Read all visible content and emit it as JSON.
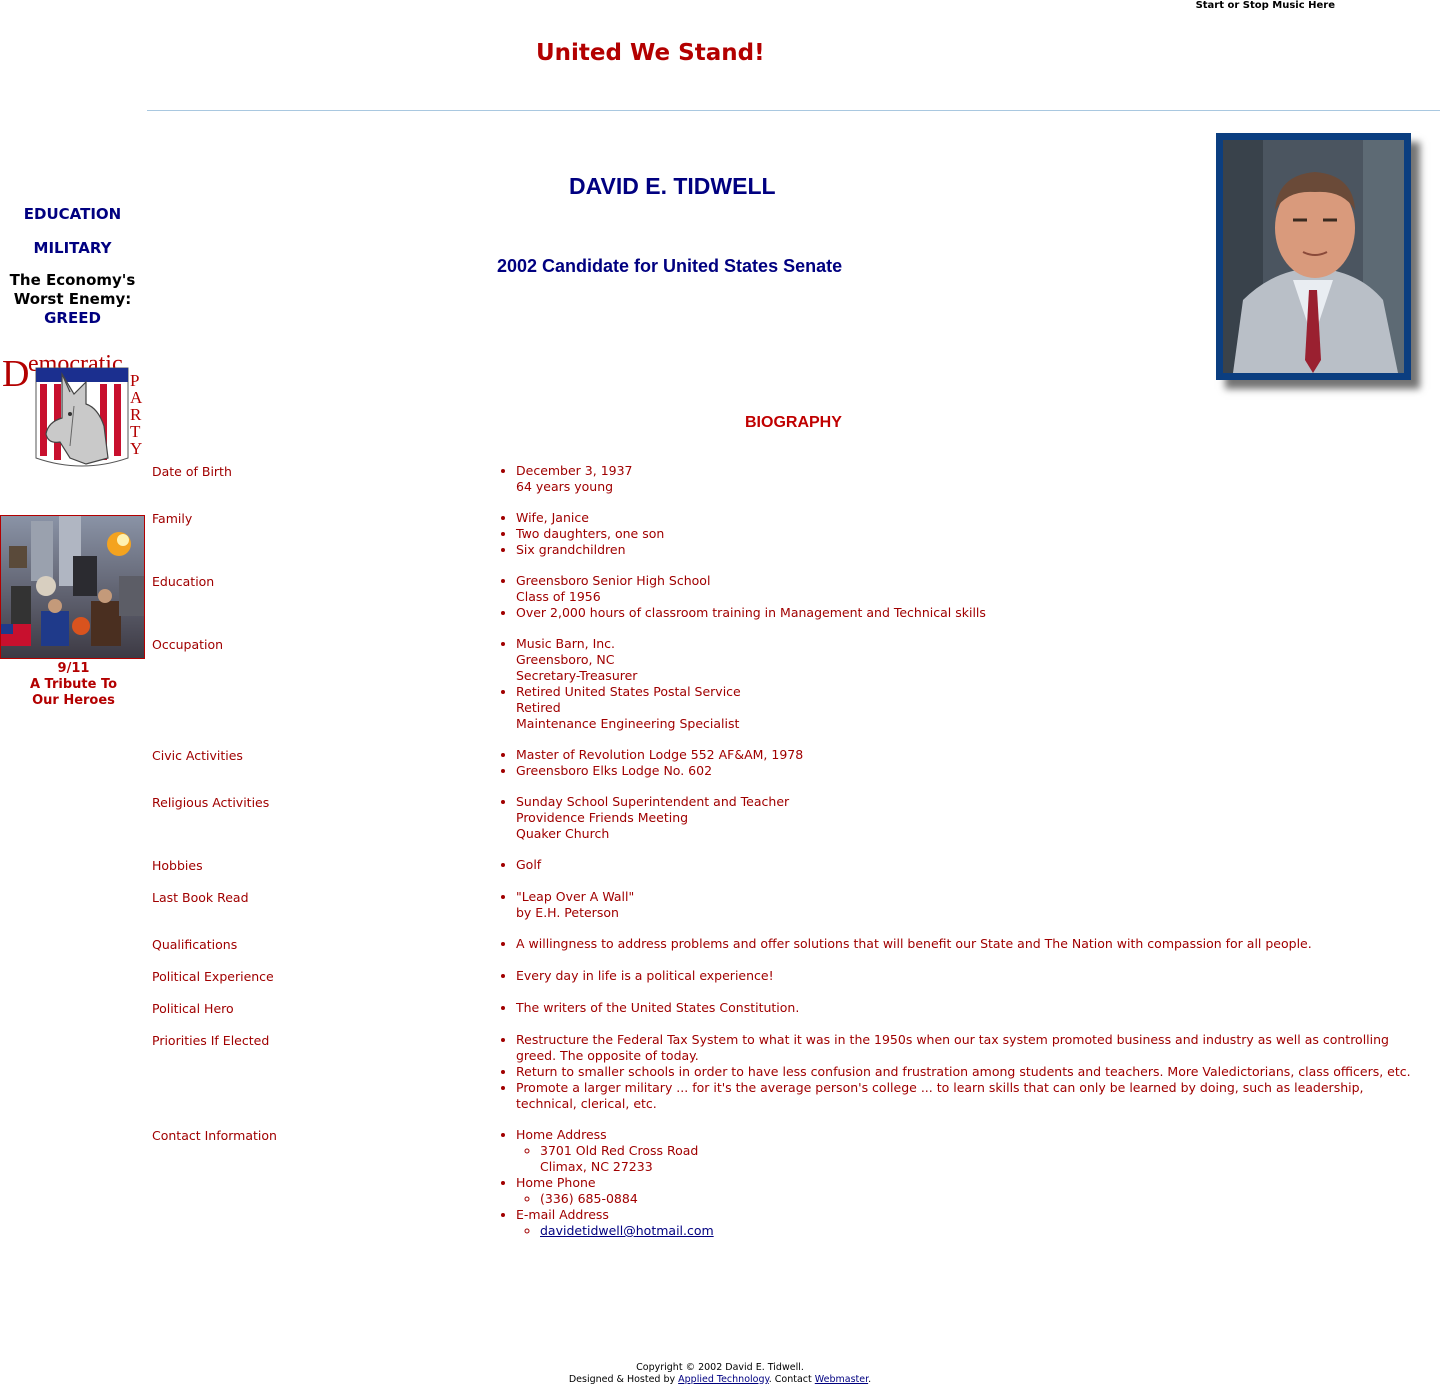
{
  "header": {
    "music_link": "Start or Stop Music Here",
    "tagline": "United We Stand!"
  },
  "sidebar": {
    "nav": [
      {
        "label": "EDUCATION"
      },
      {
        "label": "MILITARY"
      }
    ],
    "economy_line1": "The Economy's",
    "economy_line2": "Worst Enemy:",
    "economy_link": "GREED",
    "logo_word_democratic": "Democratic",
    "logo_word_party": "PARTY",
    "tribute_line1": "9/11",
    "tribute_line2": "A Tribute To",
    "tribute_line3": "Our Heroes"
  },
  "main": {
    "name": "DAVID E. TIDWELL",
    "subtitle": "2002 Candidate for United States Senate",
    "bio_title": "BIOGRAPHY",
    "bio": [
      {
        "label": "Date of Birth",
        "items": [
          [
            "December 3, 1937",
            "64 years young"
          ]
        ]
      },
      {
        "label": "Family",
        "items": [
          [
            "Wife, Janice"
          ],
          [
            "Two daughters, one son"
          ],
          [
            "Six grandchildren"
          ]
        ]
      },
      {
        "label": "Education",
        "items": [
          [
            "Greensboro Senior High School",
            "Class of 1956"
          ],
          [
            "Over 2,000 hours of classroom training in Management and Technical skills"
          ]
        ]
      },
      {
        "label": "Occupation",
        "items": [
          [
            "Music Barn, Inc.",
            "Greensboro, NC",
            "Secretary-Treasurer"
          ],
          [
            "Retired United States Postal Service",
            "Retired",
            "Maintenance Engineering Specialist"
          ]
        ]
      },
      {
        "label": "Civic Activities",
        "items": [
          [
            "Master of Revolution Lodge 552 AF&AM, 1978"
          ],
          [
            "Greensboro Elks Lodge No. 602"
          ]
        ]
      },
      {
        "label": "Religious Activities",
        "items": [
          [
            "Sunday School Superintendent and Teacher",
            "Providence Friends Meeting",
            "Quaker Church"
          ]
        ]
      },
      {
        "label": "Hobbies",
        "items": [
          [
            "Golf"
          ]
        ]
      },
      {
        "label": "Last Book Read",
        "items": [
          [
            "\"Leap Over A Wall\"",
            "by E.H. Peterson"
          ]
        ]
      },
      {
        "label": "Qualifications",
        "items": [
          [
            "A willingness to address problems and offer solutions that will benefit our State and The Nation with compassion for all people."
          ]
        ]
      },
      {
        "label": "Political Experience",
        "items": [
          [
            "Every day in life is a political experience!"
          ]
        ]
      },
      {
        "label": "Political Hero",
        "items": [
          [
            "The writers of the United States Constitution."
          ]
        ]
      },
      {
        "label": "Priorities If Elected",
        "items": [
          [
            "Restructure the Federal Tax System to what it was in the 1950s when our tax system promoted business and industry as well as controlling greed. The opposite of today."
          ],
          [
            "Return to smaller schools in order to have less confusion and frustration among students and teachers. More Valedictorians, class officers, etc."
          ],
          [
            "Promote a larger military ... for it's the average person's college ... to learn skills that can only be learned by doing, such as leadership, technical, clerical, etc."
          ]
        ]
      }
    ],
    "contact": {
      "label": "Contact Information",
      "home_address_label": "Home Address",
      "address_line1": "3701 Old Red Cross Road",
      "address_line2": "Climax, NC 27233",
      "home_phone_label": "Home Phone",
      "phone": "(336) 685-0884",
      "email_label": "E-mail Address",
      "email": "davidetidwell@hotmail.com"
    }
  },
  "footer": {
    "copyright": "Copyright © 2002 David E. Tidwell.",
    "designed_prefix": "Designed & Hosted by ",
    "designer_link": "Applied Technology",
    "contact_prefix": ". Contact ",
    "webmaster_link": "Webmaster",
    "suffix": "."
  },
  "colors": {
    "accent_red": "#b30000",
    "navy": "#000080",
    "photo_frame": "#0b3e80"
  }
}
